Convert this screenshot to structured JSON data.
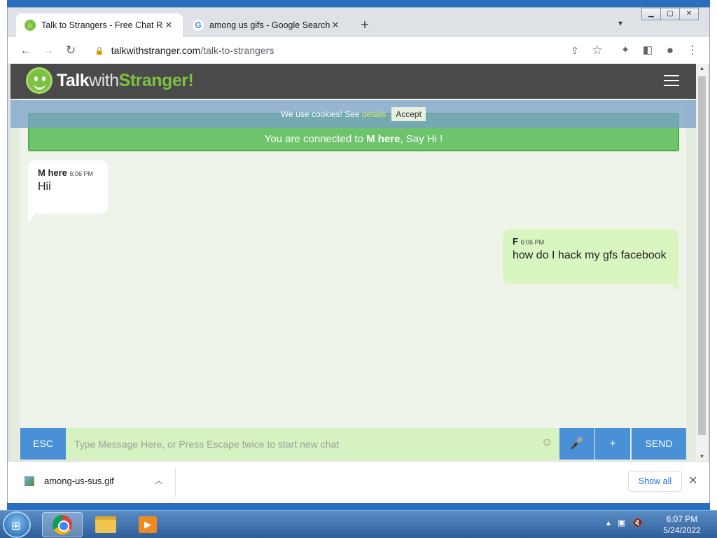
{
  "browser": {
    "tabs": [
      {
        "title": "Talk to Strangers - Free Chat Roo",
        "close": "✕"
      },
      {
        "title": "among us gifs - Google Search",
        "close": "✕"
      }
    ],
    "new_tab": "+",
    "tab_search": "⌄",
    "window_controls": {
      "minimize": "▁",
      "maximize": "▢",
      "close": "✕"
    },
    "url_host": "talkwithstranger.com",
    "url_path": "/talk-to-strangers"
  },
  "site": {
    "logo_talk": "Talk",
    "logo_with": "with",
    "logo_stranger": "Stranger!"
  },
  "cookie": {
    "text": "We use cookies! See",
    "details": "details",
    "accept": "Accept"
  },
  "connected": {
    "prefix": "You are connected to",
    "name": "M here",
    "suffix": ", Say Hi !"
  },
  "messages": [
    {
      "sender": "M here",
      "time": "6:06 PM",
      "text": "Hii"
    },
    {
      "sender": "F",
      "time": "6:06 PM",
      "text": "how do I hack my gfs facebook"
    }
  ],
  "input": {
    "esc": "ESC",
    "placeholder": "Type Message Here, or Press Escape twice to start new chat",
    "plus": "+",
    "send": "SEND"
  },
  "downloads": {
    "file": "among-us-sus.gif",
    "show_all": "Show all"
  },
  "taskbar": {
    "time": "6:07 PM",
    "date": "5/24/2022"
  },
  "colors": {
    "accent": "#4a90d6",
    "brand_green": "#7cc142",
    "connected_bg": "#6ec46c"
  }
}
